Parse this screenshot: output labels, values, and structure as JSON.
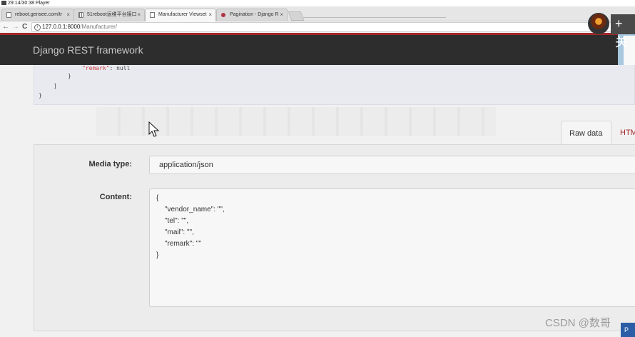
{
  "player": {
    "title": "29:14/30:38 Player"
  },
  "browser": {
    "tabs": [
      {
        "label": "reboot.gensee.com/tr",
        "icon": "document-icon",
        "active": false
      },
      {
        "label": "51reboot运维平台接口",
        "icon": "grid-icon",
        "active": false
      },
      {
        "label": "Manufacturer Viewset",
        "icon": "document-icon",
        "active": true
      },
      {
        "label": "Pagination - Django R",
        "icon": "django-icon",
        "active": false
      }
    ],
    "close_glyph": "×",
    "nav": {
      "back": "←",
      "forward": "→",
      "reload": "C"
    },
    "url_host": "127.0.0.1:8000",
    "url_path": "/Manufacturer/",
    "info_glyph": "i"
  },
  "navbar": {
    "brand": "Django REST framework",
    "accent": "#a3282b"
  },
  "response": {
    "key": "\"remark\"",
    "colon": ": ",
    "value": "null",
    "close_inner": "}",
    "close_list": "]",
    "close_outer": "}"
  },
  "format_tabs": {
    "raw": "Raw data",
    "html": "HTM"
  },
  "form": {
    "media_type_label": "Media type:",
    "media_type_value": "application/json",
    "content_label": "Content:",
    "content_lines": [
      "{",
      "\"vendor_name\": \"\",",
      "\"tel\": \"\",",
      "\"mail\": \"\",",
      "\"remark\": \"\"",
      "}"
    ]
  },
  "overlay": {
    "plus_label": "+ 关",
    "watermark": "CSDN @数哥",
    "corner_label": "P"
  }
}
